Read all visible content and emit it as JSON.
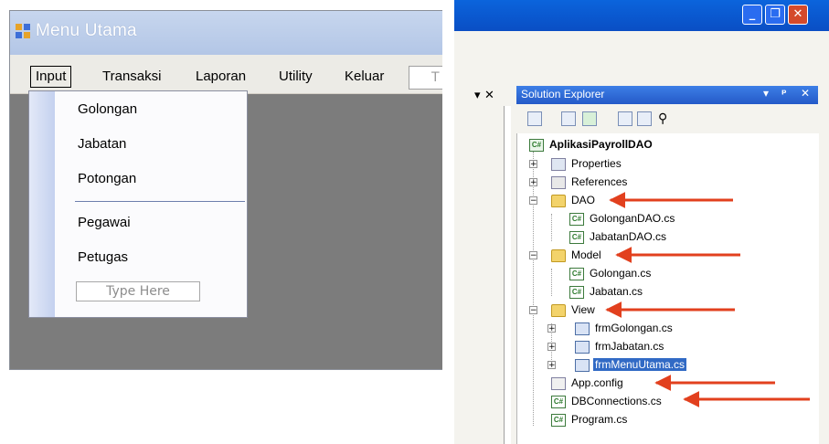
{
  "form_window": {
    "title": "Menu Utama",
    "menu": [
      "Input",
      "Transaksi",
      "Laporan",
      "Utility",
      "Keluar"
    ],
    "menu_type_here": "T",
    "dropdown_items": [
      "Golongan",
      "Jabatan",
      "Potongan",
      "Pegawai",
      "Petugas"
    ],
    "dropdown_type_here": "Type Here"
  },
  "vs_window": {
    "panel_close": "▾ ✕",
    "solution_explorer": {
      "title": "Solution Explorer",
      "controls": [
        "▾",
        "ᵖ",
        "✕"
      ],
      "project": "AplikasiPayrollDAO",
      "tree": [
        {
          "label": "Properties",
          "icon": "properties-icon",
          "expander": "+"
        },
        {
          "label": "References",
          "icon": "references-icon",
          "expander": "+"
        },
        {
          "label": "DAO",
          "icon": "folder-open-icon",
          "expander": "−"
        },
        {
          "label": "GolonganDAO.cs",
          "icon": "csharp-file-icon"
        },
        {
          "label": "JabatanDAO.cs",
          "icon": "csharp-file-icon"
        },
        {
          "label": "Model",
          "icon": "folder-open-icon",
          "expander": "−"
        },
        {
          "label": "Golongan.cs",
          "icon": "csharp-file-icon"
        },
        {
          "label": "Jabatan.cs",
          "icon": "csharp-file-icon"
        },
        {
          "label": "View",
          "icon": "folder-open-icon",
          "expander": "−"
        },
        {
          "label": "frmGolongan.cs",
          "icon": "form-icon",
          "expander": "+"
        },
        {
          "label": "frmJabatan.cs",
          "icon": "form-icon",
          "expander": "+"
        },
        {
          "label": "frmMenuUtama.cs",
          "icon": "form-icon",
          "expander": "+",
          "selected": true
        },
        {
          "label": "App.config",
          "icon": "config-file-icon"
        },
        {
          "label": "DBConnections.cs",
          "icon": "csharp-file-icon"
        },
        {
          "label": "Program.cs",
          "icon": "csharp-file-icon"
        }
      ]
    }
  },
  "colors": {
    "arrow": "#e2401e",
    "selection": "#316ac5",
    "title_bar": "#0a4ec4"
  }
}
